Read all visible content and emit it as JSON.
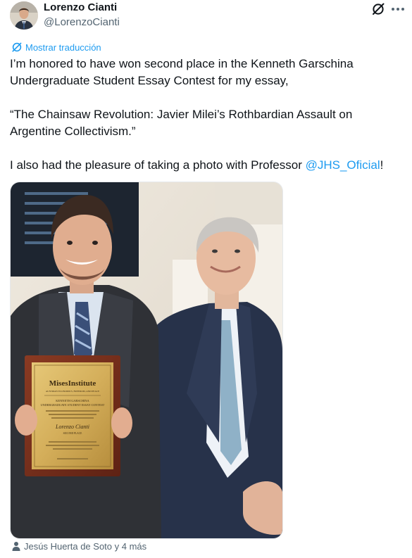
{
  "author": {
    "display_name": "Lorenzo Cianti",
    "handle": "@LorenzoCianti"
  },
  "translate_label": "Mostrar traducción",
  "tweet": {
    "line1": "I’m honored to have won second place in the Kenneth Garschina Undergraduate Student Essay Contest for my essay,",
    "line2": "“The Chainsaw Revolution: Javier Milei’s Rothbardian Assault on Argentine Collectivism.”",
    "line3_before": "I also had the pleasure of taking a photo with Professor ",
    "mention": "@JHS_Oficial",
    "line3_after": "!"
  },
  "plaque": {
    "brand": "MisesInstitute",
    "tagline": "AUSTRIAN ECONOMICS, FREEDOM, AND PEACE",
    "contest_line1": "KENNETH GARSCHINA",
    "contest_line2": "UNDERGRADUATE STUDENT ESSAY CONTEST",
    "awardee": "Lorenzo Cianti",
    "place": "SECOND PLACE"
  },
  "tagged_people": "Jesús Huerta de Soto y 4 más",
  "icons": {
    "grok": "grok-icon",
    "more": "more-icon",
    "translate": "translate-icon",
    "person": "person-icon"
  },
  "colors": {
    "link": "#1d9bf0",
    "secondary_text": "#536471",
    "primary_text": "#0f1419"
  }
}
